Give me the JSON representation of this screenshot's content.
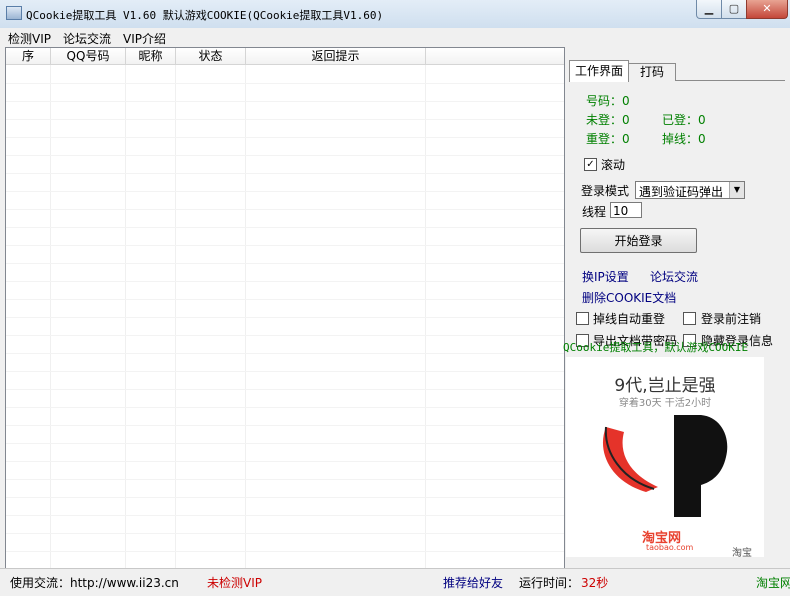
{
  "window": {
    "title": "QCookie提取工具 V1.60 默认游戏COOKIE(QCookie提取工具V1.60)"
  },
  "window_controls": {
    "min": "▁",
    "max": "▢",
    "close": "✕"
  },
  "menu": [
    "检测VIP",
    "论坛交流",
    "VIP介绍"
  ],
  "table": {
    "columns": [
      "序",
      "QQ号码",
      "昵称",
      "状态",
      "返回提示"
    ]
  },
  "tabs": [
    "工作界面",
    "打码"
  ],
  "stats": {
    "haoma": "号码：0",
    "weideng": "未登：0",
    "yideng": "已登：0",
    "chongdeng": "重登：0",
    "diaoxian": "掉线：0"
  },
  "options": {
    "scroll_label": "滚动",
    "scroll_checked": true,
    "login_mode_label": "登录模式",
    "login_mode_value": "遇到验证码弹出",
    "thread_label": "线程",
    "thread_value": "10",
    "start_button": "开始登录",
    "change_ip": "换IP设置",
    "forum": "论坛交流",
    "delete_cookie": "删除COOKIE文档",
    "auto_relogin": "掉线自动重登",
    "logout_before": "登录前注销",
    "partial_row_left": "导出文档带密码",
    "partial_row_right": "隐藏登录信息"
  },
  "ad": {
    "caption": "QCookie提取工具，默认游戏COOKIE",
    "headline": "9代,岂止是强",
    "subline": "穿着30天 干活2小时",
    "brand_cn": "淘宝网",
    "brand_en": "taobao.com",
    "mini_text": "淘宝"
  },
  "status": {
    "contact": "使用交流：http://www.ii23.cn",
    "vip_status": "未检测VIP",
    "recommend": "推荐给好友",
    "runtime_label": "运行时间：",
    "runtime_value": "32秒",
    "taobao": "淘宝网"
  },
  "colors": {
    "green": "#008000",
    "red": "#cc0000",
    "link": "#000080",
    "accent": "#e8422f"
  }
}
